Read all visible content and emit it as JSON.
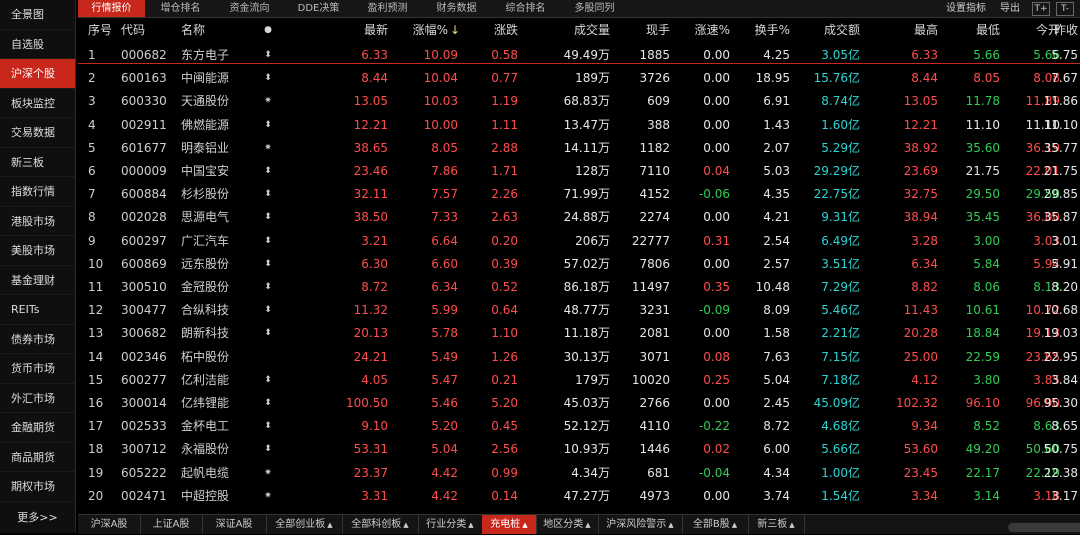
{
  "sidebar": {
    "items": [
      "全景图",
      "自选股",
      "沪深个股",
      "板块监控",
      "交易数据",
      "新三板",
      "指数行情",
      "港股市场",
      "美股市场",
      "基金理财",
      "REITs",
      "债券市场",
      "货币市场",
      "外汇市场",
      "金融期货",
      "商品期货",
      "期权市场"
    ],
    "active_index": 2,
    "more_label": "更多>>"
  },
  "top_tabs": {
    "items": [
      "行情报价",
      "增仓排名",
      "资金流向",
      "DDE决策",
      "盈利预测",
      "财务数据",
      "综合排名",
      "多股同列"
    ],
    "active_index": 0,
    "settings_label": "设置指标",
    "export_label": "导出",
    "btn_a": "T+",
    "btn_b": "T-"
  },
  "columns": [
    "序号",
    "代码",
    "名称",
    "",
    "最新",
    "涨幅%",
    "涨跌",
    "成交量",
    "现手",
    "涨速%",
    "换手%",
    "成交额",
    "最高",
    "最低",
    "今开",
    "昨收"
  ],
  "sort_indicator": "↓",
  "rows": [
    [
      "1",
      "000682",
      "东方电子",
      "⬍",
      "6.33",
      "10.09",
      "0.58",
      "49.49万",
      "1885",
      "0.00",
      "4.25",
      "3.05亿",
      "6.33",
      "5.66",
      "5.66",
      "5.75"
    ],
    [
      "2",
      "600163",
      "中闽能源",
      "⬍",
      "8.44",
      "10.04",
      "0.77",
      "189万",
      "3726",
      "0.00",
      "18.95",
      "15.76亿",
      "8.44",
      "8.05",
      "8.08",
      "7.67"
    ],
    [
      "3",
      "600330",
      "天通股份",
      "✷",
      "13.05",
      "10.03",
      "1.19",
      "68.83万",
      "609",
      "0.00",
      "6.91",
      "8.74亿",
      "13.05",
      "11.78",
      "11.89",
      "11.86"
    ],
    [
      "4",
      "002911",
      "佛燃能源",
      "⬍",
      "12.21",
      "10.00",
      "1.11",
      "13.47万",
      "388",
      "0.00",
      "1.43",
      "1.60亿",
      "12.21",
      "11.10",
      "11.10",
      "11.10"
    ],
    [
      "5",
      "601677",
      "明泰铝业",
      "✷",
      "38.65",
      "8.05",
      "2.88",
      "14.11万",
      "1182",
      "0.00",
      "2.07",
      "5.29亿",
      "38.92",
      "35.60",
      "36.19",
      "35.77"
    ],
    [
      "6",
      "000009",
      "中国宝安",
      "⬍",
      "23.46",
      "7.86",
      "1.71",
      "128万",
      "7110",
      "0.04",
      "5.03",
      "29.29亿",
      "23.69",
      "21.75",
      "22.01",
      "21.75"
    ],
    [
      "7",
      "600884",
      "杉杉股份",
      "⬍",
      "32.11",
      "7.57",
      "2.26",
      "71.99万",
      "4152",
      "-0.06",
      "4.35",
      "22.75亿",
      "32.75",
      "29.50",
      "29.50",
      "29.85"
    ],
    [
      "8",
      "002028",
      "思源电气",
      "⬍",
      "38.50",
      "7.33",
      "2.63",
      "24.88万",
      "2274",
      "0.00",
      "4.21",
      "9.31亿",
      "38.94",
      "35.45",
      "36.00",
      "35.87"
    ],
    [
      "9",
      "600297",
      "广汇汽车",
      "⬍",
      "3.21",
      "6.64",
      "0.20",
      "206万",
      "22777",
      "0.31",
      "2.54",
      "6.49亿",
      "3.28",
      "3.00",
      "3.03",
      "3.01"
    ],
    [
      "10",
      "600869",
      "远东股份",
      "⬍",
      "6.30",
      "6.60",
      "0.39",
      "57.02万",
      "7806",
      "0.00",
      "2.57",
      "3.51亿",
      "6.34",
      "5.84",
      "5.94",
      "5.91"
    ],
    [
      "11",
      "300510",
      "金冠股份",
      "⬍",
      "8.72",
      "6.34",
      "0.52",
      "86.18万",
      "11497",
      "0.35",
      "10.48",
      "7.29亿",
      "8.82",
      "8.06",
      "8.13",
      "8.20"
    ],
    [
      "12",
      "300477",
      "合纵科技",
      "⬍",
      "11.32",
      "5.99",
      "0.64",
      "48.77万",
      "3231",
      "-0.09",
      "8.09",
      "5.46亿",
      "11.43",
      "10.61",
      "10.72",
      "10.68"
    ],
    [
      "13",
      "300682",
      "朗新科技",
      "⬍",
      "20.13",
      "5.78",
      "1.10",
      "11.18万",
      "2081",
      "0.00",
      "1.58",
      "2.21亿",
      "20.28",
      "18.84",
      "19.13",
      "19.03"
    ],
    [
      "14",
      "002346",
      "柘中股份",
      "",
      "24.21",
      "5.49",
      "1.26",
      "30.13万",
      "3071",
      "0.08",
      "7.63",
      "7.15亿",
      "25.00",
      "22.59",
      "23.65",
      "22.95"
    ],
    [
      "15",
      "600277",
      "亿利洁能",
      "⬍",
      "4.05",
      "5.47",
      "0.21",
      "179万",
      "10020",
      "0.25",
      "5.04",
      "7.18亿",
      "4.12",
      "3.80",
      "3.85",
      "3.84"
    ],
    [
      "16",
      "300014",
      "亿纬锂能",
      "⬍",
      "100.50",
      "5.46",
      "5.20",
      "45.03万",
      "2766",
      "0.00",
      "2.45",
      "45.09亿",
      "102.32",
      "96.10",
      "96.90",
      "95.30"
    ],
    [
      "17",
      "002533",
      "金杯电工",
      "⬍",
      "9.10",
      "5.20",
      "0.45",
      "52.12万",
      "4110",
      "-0.22",
      "8.72",
      "4.68亿",
      "9.34",
      "8.52",
      "8.63",
      "8.65"
    ],
    [
      "18",
      "300712",
      "永福股份",
      "⬍",
      "53.31",
      "5.04",
      "2.56",
      "10.93万",
      "1446",
      "0.02",
      "6.00",
      "5.66亿",
      "53.60",
      "49.20",
      "50.60",
      "50.75"
    ],
    [
      "19",
      "605222",
      "起帆电缆",
      "✷",
      "23.37",
      "4.42",
      "0.99",
      "4.34万",
      "681",
      "-0.04",
      "4.34",
      "1.00亿",
      "23.45",
      "22.17",
      "22.19",
      "22.38"
    ],
    [
      "20",
      "002471",
      "中超控股",
      "✷",
      "3.31",
      "4.42",
      "0.14",
      "47.27万",
      "4973",
      "0.00",
      "3.74",
      "1.54亿",
      "3.34",
      "3.14",
      "3.18",
      "3.17"
    ]
  ],
  "bottom_tabs": {
    "items": [
      "沪深A股",
      "上证A股",
      "深证A股",
      "全部创业板",
      "全部科创板",
      "行业分类",
      "充电桩",
      "地区分类",
      "沪深风险警示",
      "全部B股",
      "新三板"
    ],
    "active_index": 6
  },
  "colors": {
    "up": "#ff4d4d",
    "down": "#33cc55",
    "turnover": "#2fd3d3",
    "accent": "#c8281c"
  }
}
